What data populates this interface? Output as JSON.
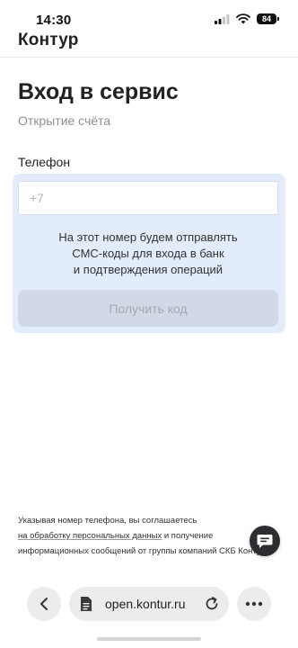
{
  "status_bar": {
    "time": "14:30",
    "battery": "84"
  },
  "app": {
    "logo": "Контур"
  },
  "header": {
    "title": "Вход в сервис",
    "subtitle": "Открытие счёта"
  },
  "phone": {
    "label": "Телефон",
    "placeholder": "+7",
    "value": "",
    "hint_lines": [
      "На этот номер будем отправлять",
      "СМС-коды для входа в банк",
      "и подтверждения операций"
    ],
    "button_label": "Получить код"
  },
  "consent": {
    "line1": "Указывая номер телефона, вы соглашаетесь",
    "link": "на обработку персональных данных",
    "line2_rest": " и получение",
    "line3": "информационных сообщений от группы компаний СКБ Контур"
  },
  "browser": {
    "url": "open.kontur.ru"
  },
  "icons": {
    "signal": "signal-icon",
    "wifi": "wifi-icon",
    "battery": "battery-icon",
    "chat": "chat-icon",
    "back": "chevron-left-icon",
    "page": "page-icon",
    "reload": "reload-icon",
    "more": "more-icon"
  },
  "colors": {
    "panel_bg": "#e3ecfb",
    "button_disabled_bg": "#d2d9e6",
    "button_disabled_text": "#a4aab3",
    "chat_bg": "#2b2d31",
    "browser_control_bg": "#ececec"
  }
}
